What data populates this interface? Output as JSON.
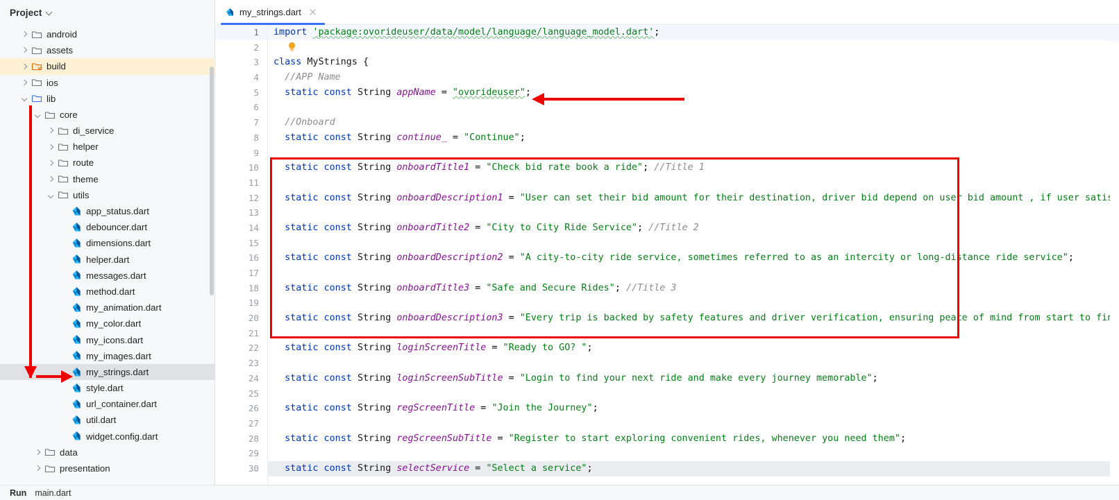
{
  "window": {
    "project_panel_title": "Project",
    "accent_color": "#3574f0",
    "annotation_color": "#ee0000"
  },
  "tab": {
    "name": "my_strings.dart",
    "icon": "dart-file-icon",
    "close_icon": "close-icon"
  },
  "sidebar": {
    "scrollbar": "vertical-scrollbar",
    "items": [
      {
        "label": "android",
        "indent": 1,
        "type": "folder",
        "state": "collapsed",
        "icon": "folder-icon",
        "highlight": "none"
      },
      {
        "label": "assets",
        "indent": 1,
        "type": "folder",
        "state": "collapsed",
        "icon": "folder-icon",
        "highlight": "none"
      },
      {
        "label": "build",
        "indent": 1,
        "type": "folder",
        "state": "collapsed",
        "icon": "folder-excluded-icon",
        "highlight": "build"
      },
      {
        "label": "ios",
        "indent": 1,
        "type": "folder",
        "state": "collapsed",
        "icon": "folder-icon",
        "highlight": "none"
      },
      {
        "label": "lib",
        "indent": 1,
        "type": "folder",
        "state": "expanded",
        "icon": "folder-source-icon",
        "highlight": "none"
      },
      {
        "label": "core",
        "indent": 2,
        "type": "folder",
        "state": "expanded",
        "icon": "folder-icon",
        "highlight": "none"
      },
      {
        "label": "di_service",
        "indent": 3,
        "type": "folder",
        "state": "collapsed",
        "icon": "folder-icon",
        "highlight": "none"
      },
      {
        "label": "helper",
        "indent": 3,
        "type": "folder",
        "state": "collapsed",
        "icon": "folder-icon",
        "highlight": "none"
      },
      {
        "label": "route",
        "indent": 3,
        "type": "folder",
        "state": "collapsed",
        "icon": "folder-icon",
        "highlight": "none"
      },
      {
        "label": "theme",
        "indent": 3,
        "type": "folder",
        "state": "collapsed",
        "icon": "folder-icon",
        "highlight": "none"
      },
      {
        "label": "utils",
        "indent": 3,
        "type": "folder",
        "state": "expanded",
        "icon": "folder-icon",
        "highlight": "none"
      },
      {
        "label": "app_status.dart",
        "indent": 4,
        "type": "file",
        "state": "none",
        "icon": "dart-file-icon",
        "highlight": "none"
      },
      {
        "label": "debouncer.dart",
        "indent": 4,
        "type": "file",
        "state": "none",
        "icon": "dart-file-icon",
        "highlight": "none"
      },
      {
        "label": "dimensions.dart",
        "indent": 4,
        "type": "file",
        "state": "none",
        "icon": "dart-file-icon",
        "highlight": "none"
      },
      {
        "label": "helper.dart",
        "indent": 4,
        "type": "file",
        "state": "none",
        "icon": "dart-file-icon",
        "highlight": "none"
      },
      {
        "label": "messages.dart",
        "indent": 4,
        "type": "file",
        "state": "none",
        "icon": "dart-file-icon",
        "highlight": "none"
      },
      {
        "label": "method.dart",
        "indent": 4,
        "type": "file",
        "state": "none",
        "icon": "dart-file-icon",
        "highlight": "none"
      },
      {
        "label": "my_animation.dart",
        "indent": 4,
        "type": "file",
        "state": "none",
        "icon": "dart-file-icon",
        "highlight": "none"
      },
      {
        "label": "my_color.dart",
        "indent": 4,
        "type": "file",
        "state": "none",
        "icon": "dart-file-icon",
        "highlight": "none"
      },
      {
        "label": "my_icons.dart",
        "indent": 4,
        "type": "file",
        "state": "none",
        "icon": "dart-file-icon",
        "highlight": "none"
      },
      {
        "label": "my_images.dart",
        "indent": 4,
        "type": "file",
        "state": "none",
        "icon": "dart-file-icon",
        "highlight": "none"
      },
      {
        "label": "my_strings.dart",
        "indent": 4,
        "type": "file",
        "state": "none",
        "icon": "dart-file-icon",
        "highlight": "selected"
      },
      {
        "label": "style.dart",
        "indent": 4,
        "type": "file",
        "state": "none",
        "icon": "dart-file-icon",
        "highlight": "none"
      },
      {
        "label": "url_container.dart",
        "indent": 4,
        "type": "file",
        "state": "none",
        "icon": "dart-file-icon",
        "highlight": "none"
      },
      {
        "label": "util.dart",
        "indent": 4,
        "type": "file",
        "state": "none",
        "icon": "dart-file-icon",
        "highlight": "none"
      },
      {
        "label": "widget.config.dart",
        "indent": 4,
        "type": "file",
        "state": "none",
        "icon": "dart-file-icon",
        "highlight": "none"
      },
      {
        "label": "data",
        "indent": 2,
        "type": "folder",
        "state": "collapsed",
        "icon": "folder-icon",
        "highlight": "none"
      },
      {
        "label": "presentation",
        "indent": 2,
        "type": "folder",
        "state": "collapsed",
        "icon": "folder-icon",
        "highlight": "none"
      }
    ]
  },
  "editor": {
    "first_visible_line": 1,
    "last_visible_line": 30,
    "current_line": 1,
    "lines": [
      {
        "n": 1,
        "tokens": [
          {
            "t": "import ",
            "c": "kw"
          },
          {
            "t": "'package:ovorideuser/data/model/language/language_model.dart'",
            "c": "strwarn"
          },
          {
            "t": ";",
            "c": "pun"
          }
        ]
      },
      {
        "n": 2,
        "tokens": [
          {
            "t": "  ",
            "c": "pun"
          }
        ],
        "bulb": true
      },
      {
        "n": 3,
        "tokens": [
          {
            "t": "class ",
            "c": "kw"
          },
          {
            "t": "MyStrings",
            "c": "type"
          },
          {
            "t": " {",
            "c": "pun"
          }
        ]
      },
      {
        "n": 4,
        "tokens": [
          {
            "t": "  //APP Name",
            "c": "cmt"
          }
        ]
      },
      {
        "n": 5,
        "tokens": [
          {
            "t": "  ",
            "c": "pun"
          },
          {
            "t": "static const ",
            "c": "kw"
          },
          {
            "t": "String ",
            "c": "type"
          },
          {
            "t": "appName",
            "c": "ident"
          },
          {
            "t": " = ",
            "c": "pun"
          },
          {
            "t": "\"ovorideuser\"",
            "c": "strwarn"
          },
          {
            "t": ";",
            "c": "pun"
          }
        ]
      },
      {
        "n": 6,
        "tokens": [
          {
            "t": "",
            "c": "pun"
          }
        ]
      },
      {
        "n": 7,
        "tokens": [
          {
            "t": "  //Onboard",
            "c": "cmt"
          }
        ]
      },
      {
        "n": 8,
        "tokens": [
          {
            "t": "  ",
            "c": "pun"
          },
          {
            "t": "static const ",
            "c": "kw"
          },
          {
            "t": "String ",
            "c": "type"
          },
          {
            "t": "continue_",
            "c": "ident"
          },
          {
            "t": " = ",
            "c": "pun"
          },
          {
            "t": "\"Continue\"",
            "c": "str"
          },
          {
            "t": ";",
            "c": "pun"
          }
        ]
      },
      {
        "n": 9,
        "tokens": [
          {
            "t": "",
            "c": "pun"
          }
        ]
      },
      {
        "n": 10,
        "tokens": [
          {
            "t": "  ",
            "c": "pun"
          },
          {
            "t": "static const ",
            "c": "kw"
          },
          {
            "t": "String ",
            "c": "type"
          },
          {
            "t": "onboardTitle1",
            "c": "ident"
          },
          {
            "t": " = ",
            "c": "pun"
          },
          {
            "t": "\"Check bid rate book a ride\"",
            "c": "str"
          },
          {
            "t": "; ",
            "c": "pun"
          },
          {
            "t": "//Title 1",
            "c": "cmt"
          }
        ]
      },
      {
        "n": 11,
        "tokens": [
          {
            "t": "",
            "c": "pun"
          }
        ]
      },
      {
        "n": 12,
        "tokens": [
          {
            "t": "  ",
            "c": "pun"
          },
          {
            "t": "static const ",
            "c": "kw"
          },
          {
            "t": "String ",
            "c": "type"
          },
          {
            "t": "onboardDescription1",
            "c": "ident"
          },
          {
            "t": " = ",
            "c": "pun"
          },
          {
            "t": "\"User can set their bid amount for their destination, driver bid depend on user bid amount , if user satisfy",
            "c": "str"
          }
        ]
      },
      {
        "n": 13,
        "tokens": [
          {
            "t": "",
            "c": "pun"
          }
        ]
      },
      {
        "n": 14,
        "tokens": [
          {
            "t": "  ",
            "c": "pun"
          },
          {
            "t": "static const ",
            "c": "kw"
          },
          {
            "t": "String ",
            "c": "type"
          },
          {
            "t": "onboardTitle2",
            "c": "ident"
          },
          {
            "t": " = ",
            "c": "pun"
          },
          {
            "t": "\"City to City Ride Service\"",
            "c": "str"
          },
          {
            "t": "; ",
            "c": "pun"
          },
          {
            "t": "//Title 2",
            "c": "cmt"
          }
        ]
      },
      {
        "n": 15,
        "tokens": [
          {
            "t": "",
            "c": "pun"
          }
        ]
      },
      {
        "n": 16,
        "tokens": [
          {
            "t": "  ",
            "c": "pun"
          },
          {
            "t": "static const ",
            "c": "kw"
          },
          {
            "t": "String ",
            "c": "type"
          },
          {
            "t": "onboardDescription2",
            "c": "ident"
          },
          {
            "t": " = ",
            "c": "pun"
          },
          {
            "t": "\"A city-to-city ride service, sometimes referred to as an intercity or long-distance ride service\"",
            "c": "str"
          },
          {
            "t": ";",
            "c": "pun"
          }
        ]
      },
      {
        "n": 17,
        "tokens": [
          {
            "t": "",
            "c": "pun"
          }
        ]
      },
      {
        "n": 18,
        "tokens": [
          {
            "t": "  ",
            "c": "pun"
          },
          {
            "t": "static const ",
            "c": "kw"
          },
          {
            "t": "String ",
            "c": "type"
          },
          {
            "t": "onboardTitle3",
            "c": "ident"
          },
          {
            "t": " = ",
            "c": "pun"
          },
          {
            "t": "\"Safe and Secure Rides\"",
            "c": "str"
          },
          {
            "t": "; ",
            "c": "pun"
          },
          {
            "t": "//Title 3",
            "c": "cmt"
          }
        ]
      },
      {
        "n": 19,
        "tokens": [
          {
            "t": "",
            "c": "pun"
          }
        ]
      },
      {
        "n": 20,
        "tokens": [
          {
            "t": "  ",
            "c": "pun"
          },
          {
            "t": "static const ",
            "c": "kw"
          },
          {
            "t": "String ",
            "c": "type"
          },
          {
            "t": "onboardDescription3",
            "c": "ident"
          },
          {
            "t": " = ",
            "c": "pun"
          },
          {
            "t": "\"Every trip is backed by safety features and driver verification, ensuring peace of mind from start to finis",
            "c": "str"
          }
        ]
      },
      {
        "n": 21,
        "tokens": [
          {
            "t": "",
            "c": "pun"
          }
        ]
      },
      {
        "n": 22,
        "tokens": [
          {
            "t": "  ",
            "c": "pun"
          },
          {
            "t": "static const ",
            "c": "kw"
          },
          {
            "t": "String ",
            "c": "type"
          },
          {
            "t": "loginScreenTitle",
            "c": "ident"
          },
          {
            "t": " = ",
            "c": "pun"
          },
          {
            "t": "\"Ready to GO? \"",
            "c": "str"
          },
          {
            "t": ";",
            "c": "pun"
          }
        ]
      },
      {
        "n": 23,
        "tokens": [
          {
            "t": "",
            "c": "pun"
          }
        ]
      },
      {
        "n": 24,
        "tokens": [
          {
            "t": "  ",
            "c": "pun"
          },
          {
            "t": "static const ",
            "c": "kw"
          },
          {
            "t": "String ",
            "c": "type"
          },
          {
            "t": "loginScreenSubTitle",
            "c": "ident"
          },
          {
            "t": " = ",
            "c": "pun"
          },
          {
            "t": "\"Login to find your next ride and make every journey memorable\"",
            "c": "str"
          },
          {
            "t": ";",
            "c": "pun"
          }
        ]
      },
      {
        "n": 25,
        "tokens": [
          {
            "t": "",
            "c": "pun"
          }
        ]
      },
      {
        "n": 26,
        "tokens": [
          {
            "t": "  ",
            "c": "pun"
          },
          {
            "t": "static const ",
            "c": "kw"
          },
          {
            "t": "String ",
            "c": "type"
          },
          {
            "t": "regScreenTitle",
            "c": "ident"
          },
          {
            "t": " = ",
            "c": "pun"
          },
          {
            "t": "\"Join the Journey\"",
            "c": "str"
          },
          {
            "t": ";",
            "c": "pun"
          }
        ]
      },
      {
        "n": 27,
        "tokens": [
          {
            "t": "",
            "c": "pun"
          }
        ]
      },
      {
        "n": 28,
        "tokens": [
          {
            "t": "  ",
            "c": "pun"
          },
          {
            "t": "static const ",
            "c": "kw"
          },
          {
            "t": "String ",
            "c": "type"
          },
          {
            "t": "regScreenSubTitle",
            "c": "ident"
          },
          {
            "t": " = ",
            "c": "pun"
          },
          {
            "t": "\"Register to start exploring convenient rides, whenever you need them\"",
            "c": "str"
          },
          {
            "t": ";",
            "c": "pun"
          }
        ]
      },
      {
        "n": 29,
        "tokens": [
          {
            "t": "",
            "c": "pun"
          }
        ]
      },
      {
        "n": 30,
        "tokens": [
          {
            "t": "  ",
            "c": "pun"
          },
          {
            "t": "static const ",
            "c": "kw"
          },
          {
            "t": "String ",
            "c": "type"
          },
          {
            "t": "selectService",
            "c": "ident"
          },
          {
            "t": " = ",
            "c": "pun"
          },
          {
            "t": "\"Select a service\"",
            "c": "str"
          },
          {
            "t": ";",
            "c": "pun"
          }
        ]
      }
    ]
  },
  "run_strip": {
    "label": "Run",
    "config": "main.dart"
  },
  "annotations": [
    {
      "name": "red-rectangle-onboard-strings",
      "shape": "rectangle"
    },
    {
      "name": "red-arrow-to-app-name",
      "shape": "arrow-left"
    },
    {
      "name": "red-arrow-to-my-strings-file",
      "shape": "arrow-down-right"
    }
  ]
}
